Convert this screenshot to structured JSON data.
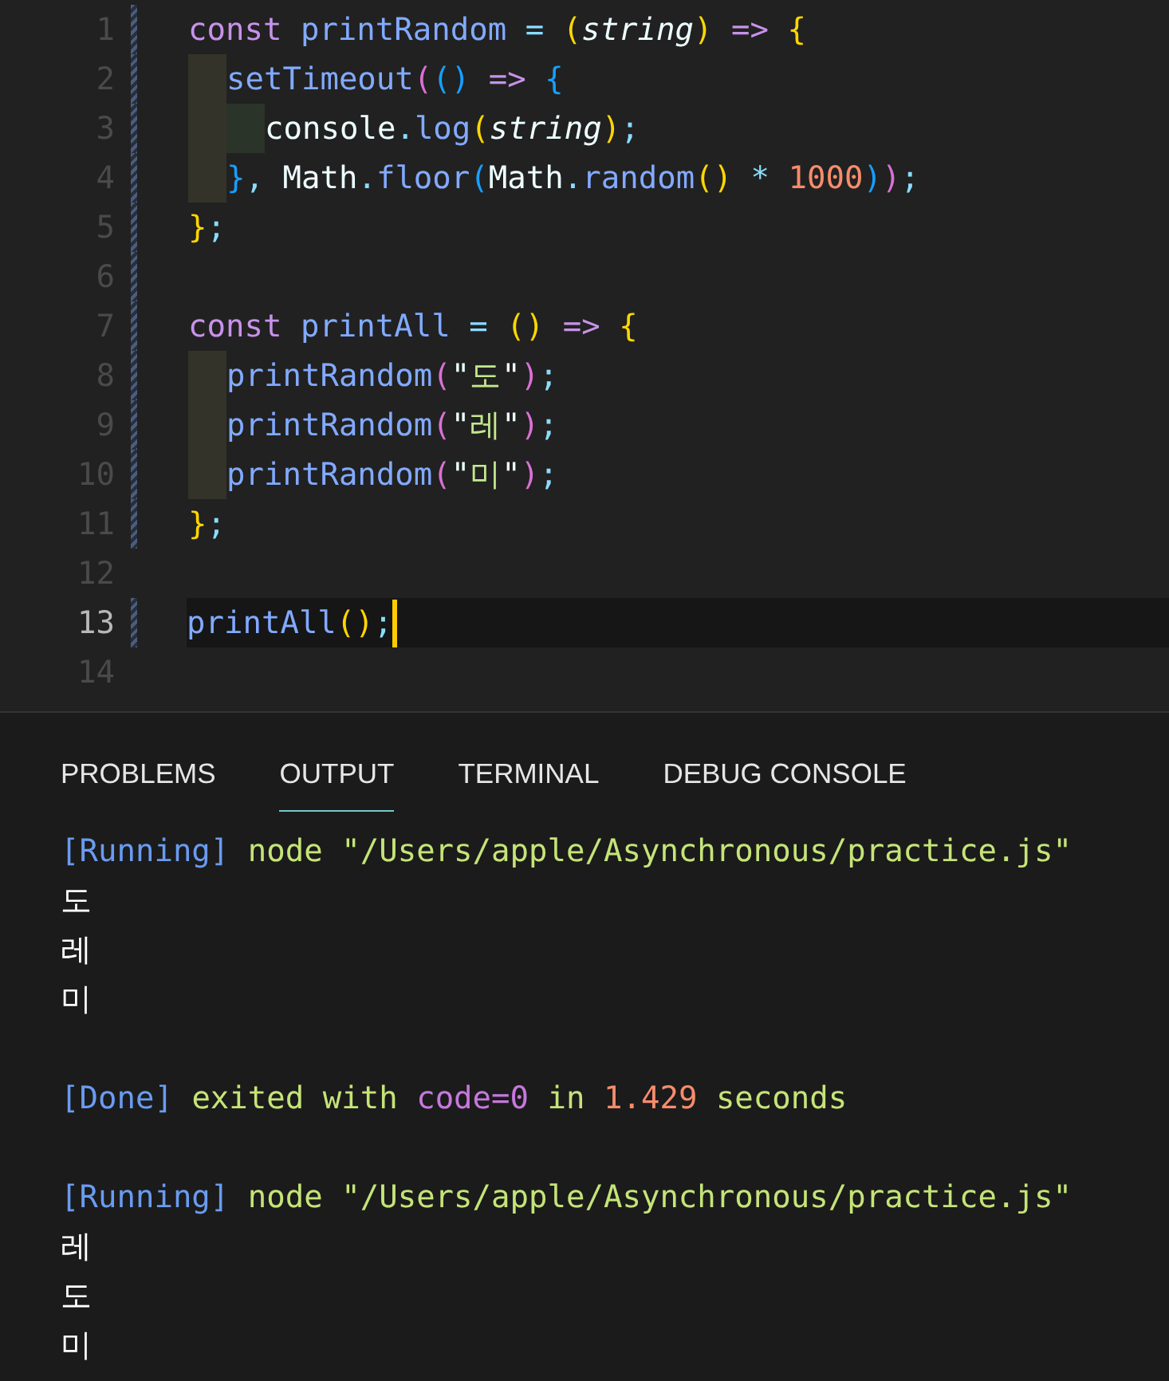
{
  "editor": {
    "lines": [
      {
        "number": "1",
        "modified": true,
        "current": false,
        "tokens": [
          {
            "kind": "keyword",
            "text": "const "
          },
          {
            "kind": "func",
            "text": "printRandom"
          },
          {
            "kind": "op",
            "text": " = "
          },
          {
            "kind": "b1",
            "text": "("
          },
          {
            "kind": "param",
            "text": "string"
          },
          {
            "kind": "b1",
            "text": ")"
          },
          {
            "kind": "arrow",
            "text": " => "
          },
          {
            "kind": "b1",
            "text": "{"
          }
        ]
      },
      {
        "number": "2",
        "modified": true,
        "current": false,
        "indent": [
          {
            "color": "#34332a"
          }
        ],
        "tokens": [
          {
            "kind": "func",
            "text": "setTimeout"
          },
          {
            "kind": "b2",
            "text": "("
          },
          {
            "kind": "b3",
            "text": "()"
          },
          {
            "kind": "arrow",
            "text": " => "
          },
          {
            "kind": "b3",
            "text": "{"
          }
        ]
      },
      {
        "number": "3",
        "modified": true,
        "current": false,
        "indent": [
          {
            "color": "#34332a"
          },
          {
            "color": "#2b3429"
          }
        ],
        "tokens": [
          {
            "kind": "plain",
            "text": "console"
          },
          {
            "kind": "op",
            "text": "."
          },
          {
            "kind": "func",
            "text": "log"
          },
          {
            "kind": "b1",
            "text": "("
          },
          {
            "kind": "param",
            "text": "string"
          },
          {
            "kind": "b1",
            "text": ")"
          },
          {
            "kind": "op",
            "text": ";"
          }
        ]
      },
      {
        "number": "4",
        "modified": true,
        "current": false,
        "indent": [
          {
            "color": "#34332a"
          }
        ],
        "tokens": [
          {
            "kind": "b3",
            "text": "}"
          },
          {
            "kind": "op",
            "text": ", "
          },
          {
            "kind": "plain",
            "text": "Math"
          },
          {
            "kind": "op",
            "text": "."
          },
          {
            "kind": "func",
            "text": "floor"
          },
          {
            "kind": "b3",
            "text": "("
          },
          {
            "kind": "plain",
            "text": "Math"
          },
          {
            "kind": "op",
            "text": "."
          },
          {
            "kind": "func",
            "text": "random"
          },
          {
            "kind": "b1",
            "text": "()"
          },
          {
            "kind": "op",
            "text": " * "
          },
          {
            "kind": "number",
            "text": "1000"
          },
          {
            "kind": "b3",
            "text": ")"
          },
          {
            "kind": "b2",
            "text": ")"
          },
          {
            "kind": "op",
            "text": ";"
          }
        ]
      },
      {
        "number": "5",
        "modified": true,
        "current": false,
        "tokens": [
          {
            "kind": "b1",
            "text": "}"
          },
          {
            "kind": "op",
            "text": ";"
          }
        ]
      },
      {
        "number": "6",
        "modified": true,
        "current": false
      },
      {
        "number": "7",
        "modified": true,
        "current": false,
        "tokens": [
          {
            "kind": "keyword",
            "text": "const "
          },
          {
            "kind": "func",
            "text": "printAll"
          },
          {
            "kind": "op",
            "text": " = "
          },
          {
            "kind": "b1",
            "text": "()"
          },
          {
            "kind": "arrow",
            "text": " => "
          },
          {
            "kind": "b1",
            "text": "{"
          }
        ]
      },
      {
        "number": "8",
        "modified": true,
        "current": false,
        "indent": [
          {
            "color": "#34332a"
          }
        ],
        "tokens": [
          {
            "kind": "func",
            "text": "printRandom"
          },
          {
            "kind": "b2",
            "text": "("
          },
          {
            "kind": "quote",
            "text": "\""
          },
          {
            "kind": "string",
            "text": "도"
          },
          {
            "kind": "quote",
            "text": "\""
          },
          {
            "kind": "b2",
            "text": ")"
          },
          {
            "kind": "op",
            "text": ";"
          }
        ]
      },
      {
        "number": "9",
        "modified": true,
        "current": false,
        "indent": [
          {
            "color": "#34332a"
          }
        ],
        "tokens": [
          {
            "kind": "func",
            "text": "printRandom"
          },
          {
            "kind": "b2",
            "text": "("
          },
          {
            "kind": "quote",
            "text": "\""
          },
          {
            "kind": "string",
            "text": "레"
          },
          {
            "kind": "quote",
            "text": "\""
          },
          {
            "kind": "b2",
            "text": ")"
          },
          {
            "kind": "op",
            "text": ";"
          }
        ]
      },
      {
        "number": "10",
        "modified": true,
        "current": false,
        "indent": [
          {
            "color": "#34332a"
          }
        ],
        "tokens": [
          {
            "kind": "func",
            "text": "printRandom"
          },
          {
            "kind": "b2",
            "text": "("
          },
          {
            "kind": "quote",
            "text": "\""
          },
          {
            "kind": "string",
            "text": "미"
          },
          {
            "kind": "quote",
            "text": "\""
          },
          {
            "kind": "b2",
            "text": ")"
          },
          {
            "kind": "op",
            "text": ";"
          }
        ]
      },
      {
        "number": "11",
        "modified": true,
        "current": false,
        "tokens": [
          {
            "kind": "b1",
            "text": "}"
          },
          {
            "kind": "op",
            "text": ";"
          }
        ]
      },
      {
        "number": "12",
        "modified": false,
        "current": false
      },
      {
        "number": "13",
        "modified": true,
        "current": true,
        "tokens": [
          {
            "kind": "func",
            "text": "printAll"
          },
          {
            "kind": "b1",
            "text": "()"
          },
          {
            "kind": "op",
            "text": ";"
          }
        ]
      },
      {
        "number": "14",
        "modified": false,
        "current": false
      }
    ]
  },
  "panel": {
    "tabs": [
      {
        "label": "PROBLEMS",
        "selected": false
      },
      {
        "label": "OUTPUT",
        "selected": true
      },
      {
        "label": "TERMINAL",
        "selected": false
      },
      {
        "label": "DEBUG CONSOLE",
        "selected": false
      }
    ],
    "output": [
      {
        "lines": [
          [
            {
              "kind": "tag",
              "text": "[Running]"
            },
            {
              "kind": "path",
              "text": " node \"/Users/apple/Asynchronous/practice.js\""
            }
          ],
          [
            {
              "kind": "text",
              "text": "도"
            }
          ],
          [
            {
              "kind": "text",
              "text": "레"
            }
          ],
          [
            {
              "kind": "text",
              "text": "미"
            }
          ]
        ]
      },
      {
        "lines": [
          [
            {
              "kind": "tag",
              "text": "[Done]"
            },
            {
              "kind": "path",
              "text": " exited with "
            },
            {
              "kind": "code",
              "text": "code=0"
            },
            {
              "kind": "path",
              "text": " in "
            },
            {
              "kind": "number",
              "text": "1.429"
            },
            {
              "kind": "path",
              "text": " seconds"
            }
          ]
        ]
      },
      {
        "lines": [
          [
            {
              "kind": "tag",
              "text": "[Running]"
            },
            {
              "kind": "path",
              "text": " node \"/Users/apple/Asynchronous/practice.js\""
            }
          ],
          [
            {
              "kind": "text",
              "text": "레"
            }
          ],
          [
            {
              "kind": "text",
              "text": "도"
            }
          ],
          [
            {
              "kind": "text",
              "text": "미"
            }
          ]
        ]
      }
    ]
  }
}
